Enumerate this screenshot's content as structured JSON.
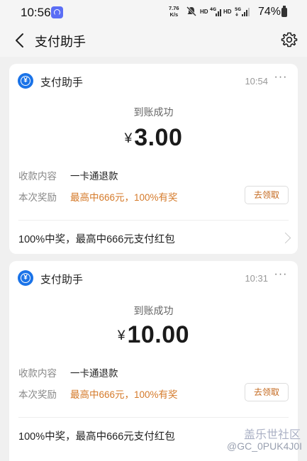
{
  "status_bar": {
    "time": "10:56",
    "net_speed_value": "7.76",
    "net_speed_unit": "K/s",
    "hd_1": "HD",
    "hd_2": "HD",
    "signal_1_tag": "4G",
    "signal_2_tag": "5G",
    "battery_text": "74%"
  },
  "header": {
    "title": "支付助手"
  },
  "messages": [
    {
      "sender": "支付助手",
      "time": "10:54",
      "status": "到账成功",
      "currency": "¥",
      "amount": "3.00",
      "row1_label": "收款内容",
      "row1_value": "一卡通退款",
      "row2_label": "本次奖励",
      "row2_value": "最高中666元，100%有奖",
      "claim_label": "去领取",
      "promo_text": "100%中奖，最高中666元支付红包"
    },
    {
      "sender": "支付助手",
      "time": "10:31",
      "status": "到账成功",
      "currency": "¥",
      "amount": "10.00",
      "row1_label": "收款内容",
      "row1_value": "一卡通退款",
      "row2_label": "本次奖励",
      "row2_value": "最高中666元，100%有奖",
      "claim_label": "去领取",
      "promo_text": "100%中奖，最高中666元支付红包"
    }
  ],
  "watermark": {
    "line1": "盖乐世社区",
    "line2": "@GC_0PUK4J0I"
  },
  "colors": {
    "accent_orange": "#d57a2a",
    "logo_blue": "#1a73e8",
    "background": "#f0f0f0"
  }
}
